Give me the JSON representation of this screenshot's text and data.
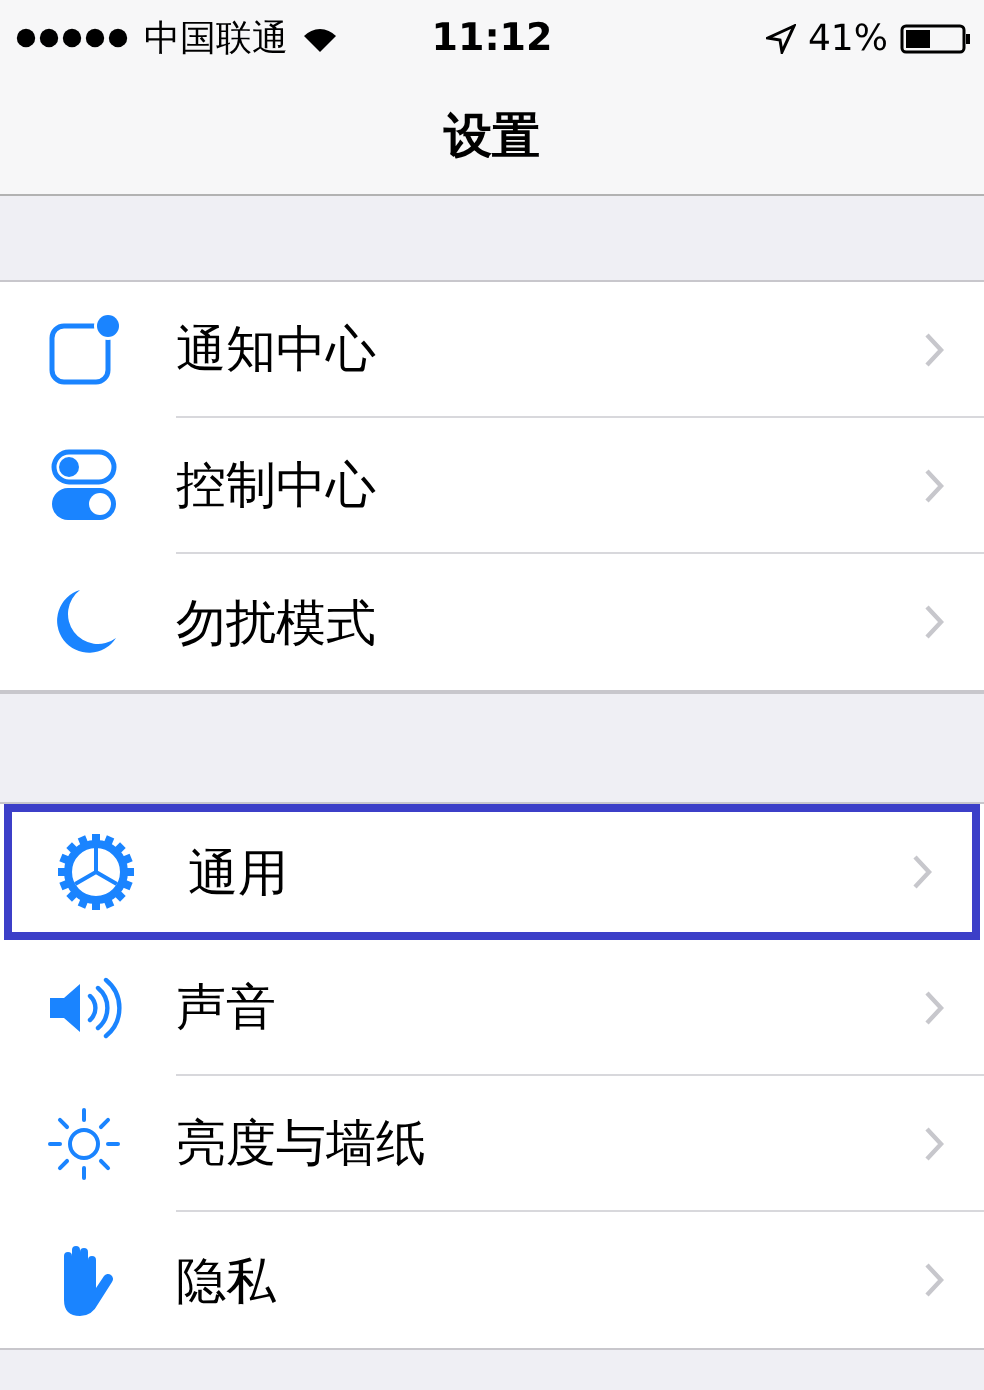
{
  "status_bar": {
    "carrier": "中国联通",
    "time": "11:12",
    "battery": "41%"
  },
  "nav": {
    "title": "设置"
  },
  "groups": [
    {
      "rows": [
        {
          "kind": "notifications",
          "label": "通知中心",
          "highlighted": false
        },
        {
          "kind": "toggles",
          "label": "控制中心",
          "highlighted": false
        },
        {
          "kind": "moon",
          "label": "勿扰模式",
          "highlighted": false
        }
      ]
    },
    {
      "rows": [
        {
          "kind": "gear",
          "label": "通用",
          "highlighted": true
        },
        {
          "kind": "speaker",
          "label": "声音",
          "highlighted": false
        },
        {
          "kind": "sun",
          "label": "亮度与墙纸",
          "highlighted": false
        },
        {
          "kind": "hand",
          "label": "隐私",
          "highlighted": false
        }
      ]
    }
  ]
}
